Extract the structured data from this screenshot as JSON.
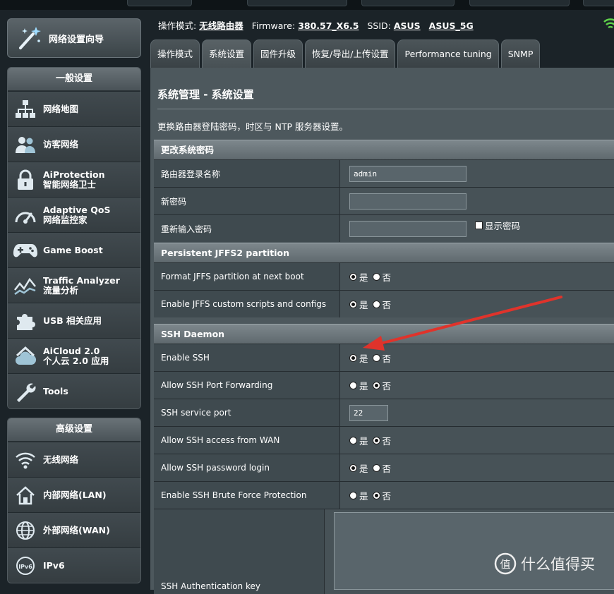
{
  "sidebar": {
    "wizard_label": "网络设置向导",
    "general_header": "一般设置",
    "general_items": [
      {
        "l1": "网络地图",
        "l2": ""
      },
      {
        "l1": "访客网络",
        "l2": ""
      },
      {
        "l1": "AiProtection",
        "l2": "智能网络卫士"
      },
      {
        "l1": "Adaptive QoS",
        "l2": "网络监控家"
      },
      {
        "l1": "Game Boost",
        "l2": ""
      },
      {
        "l1": "Traffic Analyzer",
        "l2": "流量分析"
      },
      {
        "l1": "USB 相关应用",
        "l2": ""
      },
      {
        "l1": "AiCloud 2.0",
        "l2": "个人云 2.0 应用"
      },
      {
        "l1": "Tools",
        "l2": ""
      }
    ],
    "advanced_header": "高级设置",
    "advanced_items": [
      {
        "l1": "无线网络"
      },
      {
        "l1": "内部网络(LAN)"
      },
      {
        "l1": "外部网络(WAN)"
      },
      {
        "l1": "IPv6"
      }
    ]
  },
  "status": {
    "mode_label": "操作模式:",
    "mode_value": "无线路由器",
    "fw_label": "Firmware:",
    "fw_value": "380.57_X6.5",
    "ssid_label": "SSID:",
    "ssid1": "ASUS",
    "ssid2": "ASUS_5G"
  },
  "tabs": [
    "操作模式",
    "系统设置",
    "固件升级",
    "恢复/导出/上传设置",
    "Performance tuning",
    "SNMP"
  ],
  "active_tab": 1,
  "page": {
    "title": "系统管理 - 系统设置",
    "desc": "更换路由器登陆密码，时区与 NTP 服务器设置。"
  },
  "section_password": {
    "header": "更改系统密码",
    "rows": {
      "login_name_label": "路由器登录名称",
      "login_name_value": "admin",
      "new_pw_label": "新密码",
      "confirm_pw_label": "重新输入密码",
      "show_pw_label": "显示密码"
    }
  },
  "section_jffs": {
    "header": "Persistent JFFS2 partition",
    "format_label": "Format JFFS partition at next boot",
    "scripts_label": "Enable JFFS custom scripts and configs"
  },
  "section_ssh": {
    "header": "SSH Daemon",
    "enable_label": "Enable SSH",
    "fwd_label": "Allow SSH Port Forwarding",
    "port_label": "SSH service port",
    "port_value": "22",
    "wan_label": "Allow SSH access from WAN",
    "pwlogin_label": "Allow SSH password login",
    "brute_label": "Enable SSH Brute Force Protection",
    "authkey_label": "SSH Authentication key"
  },
  "radio": {
    "yes": "是",
    "no": "否"
  },
  "watermark": {
    "text": "什么值得买",
    "glyph": "值"
  },
  "colors": {
    "arrow": "#e0332b",
    "bg": "#1b2328",
    "panel": "#4d585d"
  }
}
